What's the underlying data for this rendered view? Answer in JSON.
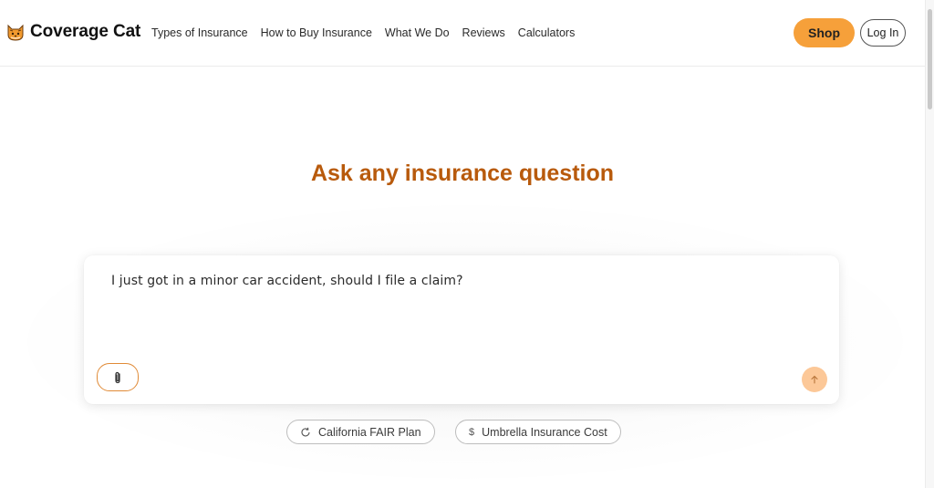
{
  "brand": {
    "name": "Coverage Cat",
    "logo_icon": "cat-face-icon"
  },
  "nav": {
    "items": [
      {
        "label": "Types of Insurance"
      },
      {
        "label": "How to Buy Insurance"
      },
      {
        "label": "What We Do"
      },
      {
        "label": "Reviews"
      },
      {
        "label": "Calculators"
      }
    ]
  },
  "header_actions": {
    "shop_label": "Shop",
    "login_label": "Log In"
  },
  "hero": {
    "title": "Ask any insurance question"
  },
  "chat": {
    "input_value": "I just got in a minor car accident, should I file a claim?",
    "attach_icon": "paperclip-icon",
    "send_icon": "arrow-up-icon"
  },
  "suggestions": [
    {
      "label": "California FAIR Plan",
      "icon": "refresh-icon"
    },
    {
      "label": "Umbrella Insurance Cost",
      "icon": "dollar-icon",
      "glyph": "$"
    }
  ],
  "colors": {
    "accent": "#f6a03a",
    "title": "#b85a0c",
    "send_disabled": "#fcc898",
    "attach_border": "#e08a36"
  }
}
